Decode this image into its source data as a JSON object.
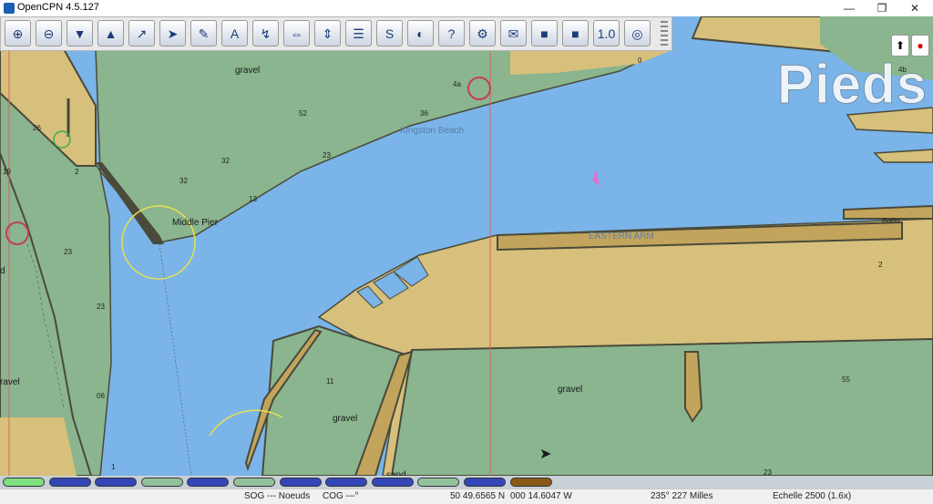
{
  "window": {
    "title": "OpenCPN 4.5.127",
    "minimize": "—",
    "maximize": "❐",
    "close": "✕"
  },
  "toolbar": [
    {
      "name": "zoom-in-button",
      "glyph": "⊕"
    },
    {
      "name": "zoom-out-button",
      "glyph": "⊖"
    },
    {
      "name": "scale-down-button",
      "glyph": "▼"
    },
    {
      "name": "scale-up-button",
      "glyph": "▲"
    },
    {
      "name": "route-button",
      "glyph": "↗"
    },
    {
      "name": "auto-follow-button",
      "glyph": "➤"
    },
    {
      "name": "settings-button",
      "glyph": "✎"
    },
    {
      "name": "text-button",
      "glyph": "A"
    },
    {
      "name": "current-button",
      "glyph": "↯"
    },
    {
      "name": "tide-button",
      "glyph": "⇔"
    },
    {
      "name": "course-up-button",
      "glyph": "⇕"
    },
    {
      "name": "route-manager-button",
      "glyph": "☰"
    },
    {
      "name": "track-button",
      "glyph": "S"
    },
    {
      "name": "color-scheme-button",
      "glyph": "◐"
    },
    {
      "name": "help-button",
      "glyph": "?"
    },
    {
      "name": "plugin-button",
      "glyph": "⚙"
    },
    {
      "name": "print-button",
      "glyph": "✉"
    },
    {
      "name": "layer-button-1",
      "glyph": "■"
    },
    {
      "name": "layer-button-2",
      "glyph": "■"
    },
    {
      "name": "counter-button",
      "glyph": "1.0"
    },
    {
      "name": "mob-button",
      "glyph": "◎"
    }
  ],
  "chart": {
    "overlay_text": "Pieds",
    "labels": {
      "gravel_top": "gravel",
      "kingston_beach": "Kingston Beach",
      "middle_pier": "Middle Pier",
      "eastern_arm": "EASTERN ARM",
      "gravel_bottom_mid": "gravel",
      "gravel_bottom_right": "gravel",
      "gravel_left": "ravel",
      "d_left": "d",
      "sand": "sand",
      "bobo": "BoBo"
    },
    "soundings": [
      "26",
      "2",
      "19",
      "23",
      "23",
      "06",
      "52",
      "32",
      "32",
      "13",
      "23",
      "36",
      "4a",
      "0",
      "4b",
      "1",
      "11",
      "55",
      "23",
      "2"
    ]
  },
  "pianobar": [
    {
      "color": "#7ee07e",
      "border": "#333"
    },
    {
      "color": "#3347b8",
      "border": "#333"
    },
    {
      "color": "#3347b8",
      "border": "#333"
    },
    {
      "color": "#93c39d",
      "border": "#333"
    },
    {
      "color": "#3347b8",
      "border": "#333"
    },
    {
      "color": "#93c39d",
      "border": "#333"
    },
    {
      "color": "#3347b8",
      "border": "#333"
    },
    {
      "color": "#3347b8",
      "border": "#333"
    },
    {
      "color": "#3347b8",
      "border": "#333"
    },
    {
      "color": "#93c39d",
      "border": "#333"
    },
    {
      "color": "#3347b8",
      "border": "#333"
    },
    {
      "color": "#8b5a18",
      "border": "#333"
    }
  ],
  "status": {
    "sog": "SOG --- Noeuds",
    "cog": "COG ---°",
    "lat": "50 49.6565 N",
    "lon": "000 14.6047 W",
    "bearing": "235°  227 Milles",
    "scale": "Echelle 2500 (1.6x)"
  },
  "colors": {
    "water": "#7ab4e8",
    "land": "#d7c07c",
    "intertidal": "#8ab58e",
    "pier": "#c2a45c",
    "outline": "#4a4a3a"
  }
}
